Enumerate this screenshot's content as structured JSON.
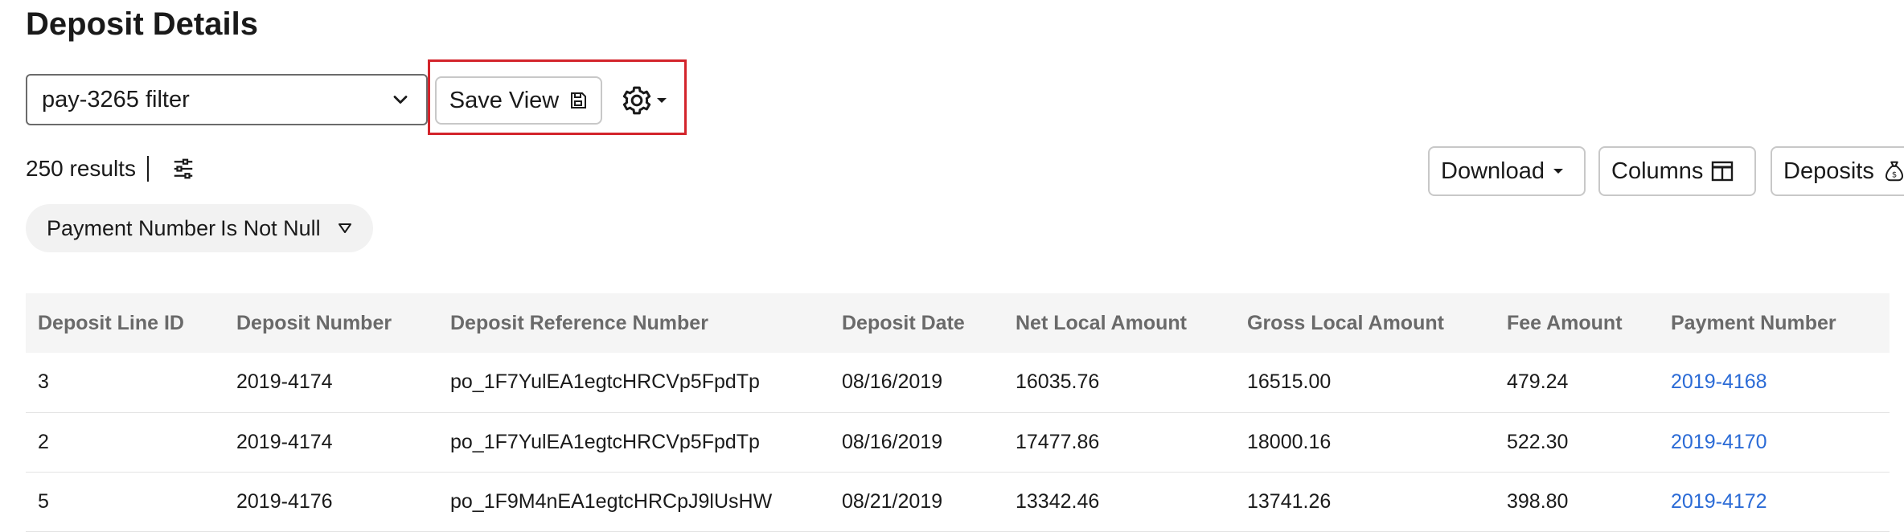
{
  "header": {
    "title": "Deposit Details"
  },
  "view_select": {
    "value": "pay-3265 filter"
  },
  "toolbar": {
    "save_view_label": "Save View",
    "results_text": "250 results",
    "download_label": "Download",
    "columns_label": "Columns",
    "deposits_label": "Deposits"
  },
  "filter_chip": {
    "field": "Payment Number",
    "operator": "Is Not Null"
  },
  "table": {
    "columns": [
      "Deposit Line ID",
      "Deposit Number",
      "Deposit Reference Number",
      "Deposit Date",
      "Net Local Amount",
      "Gross Local Amount",
      "Fee Amount",
      "Payment Number"
    ],
    "rows": [
      [
        "3",
        "2019-4174",
        "po_1F7YulEA1egtcHRCVp5FpdTp",
        "08/16/2019",
        "16035.76",
        "16515.00",
        "479.24",
        "2019-4168"
      ],
      [
        "2",
        "2019-4174",
        "po_1F7YulEA1egtcHRCVp5FpdTp",
        "08/16/2019",
        "17477.86",
        "18000.16",
        "522.30",
        "2019-4170"
      ],
      [
        "5",
        "2019-4176",
        "po_1F9M4nEA1egtcHRCpJ9lUsHW",
        "08/21/2019",
        "13342.46",
        "13741.26",
        "398.80",
        "2019-4172"
      ]
    ]
  },
  "colors": {
    "link": "#2b6bd6",
    "highlight": "#d3242b",
    "header_bg": "#f5f5f5"
  }
}
